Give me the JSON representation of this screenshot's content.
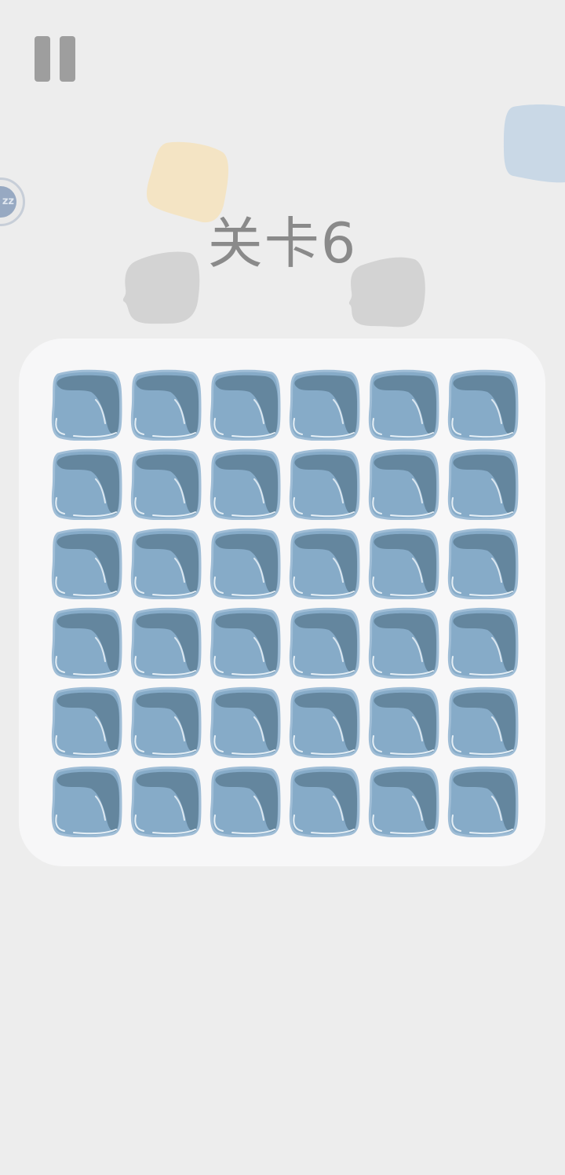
{
  "level": {
    "title": "关卡6"
  },
  "side_indicator": {
    "label": "zz"
  },
  "board": {
    "rows": 6,
    "columns": 6,
    "tile_type": "blue-ice-block"
  },
  "colors": {
    "background": "#ededed",
    "board": "#f7f7f8",
    "tile_light": "#86abc8",
    "tile_dark": "#64869e",
    "tile_edge": "#9fbdd6",
    "deco_yellow": "#f4e4c4",
    "deco_blue": "#c9d8e6",
    "deco_gray": "#d3d3d3"
  }
}
